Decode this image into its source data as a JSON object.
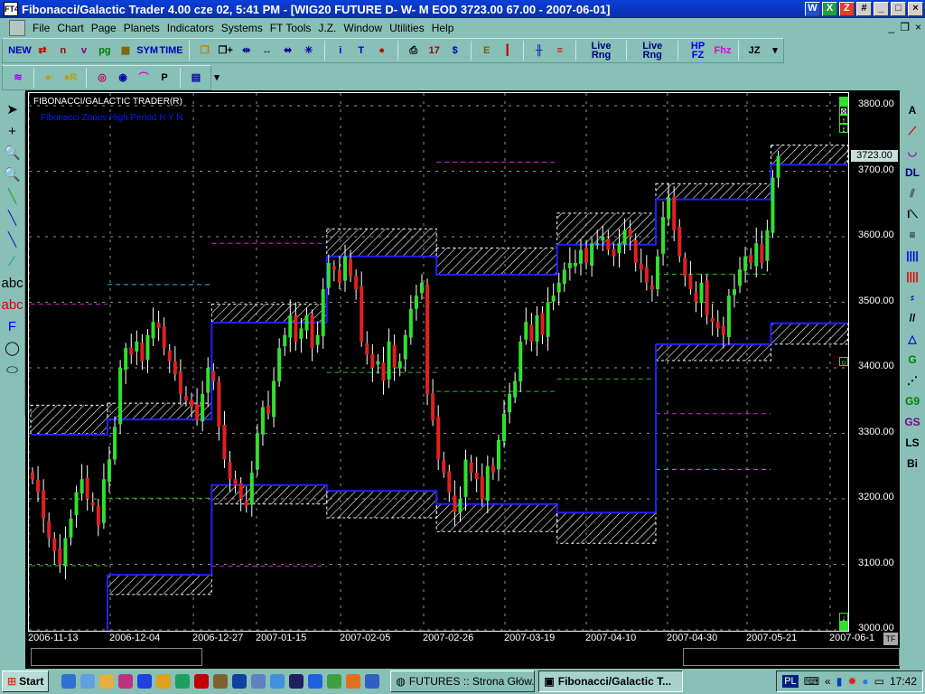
{
  "window": {
    "title": "Fibonacci/Galactic Trader 4.00 cze 02,  5:41 PM - [WIG20 FUTURE D- W- M EOD  3723.00      67.00 - 2007-06-01]",
    "app_icon": "FT4"
  },
  "title_icons": [
    "W",
    "X",
    "Z",
    "#"
  ],
  "menu": [
    "File",
    "Chart",
    "Page",
    "Planets",
    "Indicators",
    "Systems",
    "FT Tools",
    "J.Z.",
    "Window",
    "Utilities",
    "Help"
  ],
  "toolbar1": [
    {
      "name": "new-icon",
      "label": "NEW",
      "color": "#0000c0"
    },
    {
      "name": "open-icon",
      "label": "⇄",
      "color": "#c00"
    },
    {
      "name": "chart-n-icon",
      "label": "n",
      "color": "#a00000"
    },
    {
      "name": "chart-v-icon",
      "label": "v",
      "color": "#800080"
    },
    {
      "name": "pg-icon",
      "label": "pg",
      "color": "#008000"
    },
    {
      "name": "grid-icon",
      "label": "▦",
      "color": "#806000"
    },
    {
      "name": "sym-icon",
      "label": "SYM",
      "color": "#0000c0"
    },
    {
      "name": "time-icon",
      "label": "TIME",
      "color": "#0000c0"
    },
    {
      "name": "sep"
    },
    {
      "name": "windows-icon",
      "label": "❐",
      "color": "#c08000"
    },
    {
      "name": "add-window-icon",
      "label": "❐+",
      "color": "#000"
    },
    {
      "name": "compress-icon",
      "label": "⇹",
      "color": "#0000a0"
    },
    {
      "name": "expand-icon",
      "label": "↔",
      "color": "#0000a0"
    },
    {
      "name": "move-icon",
      "label": "⬌",
      "color": "#0000a0"
    },
    {
      "name": "zoom-icon",
      "label": "✳",
      "color": "#0000a0"
    },
    {
      "name": "sep"
    },
    {
      "name": "info-icon",
      "label": "i",
      "color": "#0000e0"
    },
    {
      "name": "text-icon",
      "label": "T",
      "color": "#0000e0"
    },
    {
      "name": "traffic-light-icon",
      "label": "●",
      "color": "#c00000"
    },
    {
      "name": "sep"
    },
    {
      "name": "print-icon",
      "label": "⎙",
      "color": "#000"
    },
    {
      "name": "calendar-icon",
      "label": "17",
      "color": "#a00"
    },
    {
      "name": "dollar-icon",
      "label": "$",
      "color": "#0000c0"
    },
    {
      "name": "sep"
    },
    {
      "name": "ruler-icon",
      "label": "E",
      "color": "#806000"
    },
    {
      "name": "candle-icon",
      "label": "┃",
      "color": "#c00"
    },
    {
      "name": "sep"
    },
    {
      "name": "bars-icon",
      "label": "╫",
      "color": "#0000c0"
    },
    {
      "name": "fib-lines-icon",
      "label": "≡",
      "color": "#c00"
    },
    {
      "name": "sep"
    },
    {
      "name": "live-rng-red-icon",
      "label": "Live Rng",
      "color": "#000080"
    },
    {
      "name": "sep"
    },
    {
      "name": "live-rng-blue-icon",
      "label": "Live Rng",
      "color": "#000080"
    },
    {
      "name": "sep"
    },
    {
      "name": "hp-fz-icon",
      "label": "HP FZ",
      "color": "#0000e0"
    },
    {
      "name": "fhz-icon",
      "label": "Fhz",
      "color": "#e000e0"
    },
    {
      "name": "sep"
    },
    {
      "name": "jz-icon",
      "label": "JZ",
      "color": "#000"
    }
  ],
  "toolbar2": [
    {
      "name": "waves-icon",
      "label": "≋",
      "color": "#a000ff"
    },
    {
      "name": "sep"
    },
    {
      "name": "planet-icon",
      "label": "●·",
      "color": "#c0a000"
    },
    {
      "name": "planet-r-icon",
      "label": "●R",
      "color": "#c0a000"
    },
    {
      "name": "sep"
    },
    {
      "name": "target-icon",
      "label": "◎",
      "color": "#c00060"
    },
    {
      "name": "circle-dots-icon",
      "label": "◉",
      "color": "#0000a0"
    },
    {
      "name": "arc-icon",
      "label": "⌒",
      "color": "#e000e0"
    },
    {
      "name": "p-curve-icon",
      "label": "P",
      "color": "#000"
    },
    {
      "name": "sep"
    },
    {
      "name": "template-icon",
      "label": "▤",
      "color": "#0000a0"
    }
  ],
  "left_tools": [
    {
      "name": "pointer-icon",
      "label": "➤",
      "color": "#000"
    },
    {
      "name": "crosshair-icon",
      "label": "+",
      "color": "#000"
    },
    {
      "name": "zoom-find-icon",
      "label": "🔍",
      "color": "#000"
    },
    {
      "name": "zoom-find-disabled-icon",
      "label": "🔍",
      "color": "#6a9"
    },
    {
      "name": "trendline-green-icon",
      "label": "╲",
      "color": "#20b020"
    },
    {
      "name": "trendline-blue-icon",
      "label": "╲",
      "color": "#2020c0"
    },
    {
      "name": "trendline-steep-icon",
      "label": "╲",
      "color": "#2020c0"
    },
    {
      "name": "pencil-icon",
      "label": "∕",
      "color": "#00a0c0"
    },
    {
      "name": "text-abc-icon",
      "label": "abc",
      "color": "#000"
    },
    {
      "name": "delete-text-icon",
      "label": "abc",
      "color": "#e00000"
    },
    {
      "name": "font-icon",
      "label": "F",
      "color": "#0000e0"
    },
    {
      "name": "circle-icon",
      "label": "◯",
      "color": "#000"
    },
    {
      "name": "ellipse-icon",
      "label": "⬭",
      "color": "#000"
    }
  ],
  "right_tools": [
    {
      "name": "andrews-icon",
      "label": "A",
      "color": "#000"
    },
    {
      "name": "fan-icon",
      "label": "⟋",
      "color": "#c00"
    },
    {
      "name": "arcs-icon",
      "label": "◡",
      "color": "#a000a0"
    },
    {
      "name": "dl-icon",
      "label": "DL",
      "color": "#000080"
    },
    {
      "name": "parallel-icon",
      "label": "⫽",
      "color": "#444"
    },
    {
      "name": "retrace-icon",
      "label": "I⟍",
      "color": "#000"
    },
    {
      "name": "hlines-icon",
      "label": "≡",
      "color": "#000"
    },
    {
      "name": "vlines-blue-icon",
      "label": "||||",
      "color": "#0000e0"
    },
    {
      "name": "vlines-red-icon",
      "label": "||||",
      "color": "#e00000"
    },
    {
      "name": "cycles-icon",
      "label": "⸗",
      "color": "#0000e0"
    },
    {
      "name": "diag-icon",
      "label": "//",
      "color": "#000"
    },
    {
      "name": "triangle-icon",
      "label": "△",
      "color": "#0000e0"
    },
    {
      "name": "g-lines-icon",
      "label": "G",
      "color": "#008000"
    },
    {
      "name": "gann-fan-icon",
      "label": "⋰",
      "color": "#000"
    },
    {
      "name": "g9-icon",
      "label": "G9",
      "color": "#008000"
    },
    {
      "name": "gs-icon",
      "label": "GS",
      "color": "#800080"
    },
    {
      "name": "ls-icon",
      "label": "LS",
      "color": "#000"
    },
    {
      "name": "bi-icon",
      "label": "Bi",
      "color": "#000"
    }
  ],
  "chart": {
    "header": "FIBONACCI/GALACTIC TRADER(R)",
    "study": "Fibonacci Zones High Period H Y N",
    "last_price": "3723.00",
    "tf_label": "TF",
    "colors": {
      "up": "#30e030",
      "down": "#e02020",
      "zone_line": "#2020ff",
      "grid": "#909090"
    }
  },
  "chart_data": {
    "type": "candlestick",
    "title": "WIG20 FUTURE D- W- M EOD",
    "ylim": [
      3000,
      3800
    ],
    "yticks": [
      "3000.00",
      "3100.00",
      "3200.00",
      "3300.00",
      "3400.00",
      "3500.00",
      "3600.00",
      "3700.00",
      "3800.00"
    ],
    "xticks": [
      "2006-11-13",
      "2006-12-04",
      "2006-12-27",
      "2007-01-15",
      "2007-02-05",
      "2007-02-26",
      "2007-03-19",
      "2007-04-10",
      "2007-04-30",
      "2007-05-21",
      "2007-06-1"
    ],
    "close": [
      3230,
      3210,
      3170,
      3140,
      3120,
      3100,
      3140,
      3170,
      3210,
      3230,
      3200,
      3190,
      3160,
      3230,
      3260,
      3310,
      3400,
      3430,
      3420,
      3440,
      3410,
      3450,
      3470,
      3460,
      3430,
      3410,
      3390,
      3360,
      3350,
      3340,
      3320,
      3360,
      3400,
      3380,
      3310,
      3260,
      3230,
      3220,
      3200,
      3190,
      3240,
      3300,
      3340,
      3330,
      3380,
      3430,
      3450,
      3480,
      3440,
      3460,
      3480,
      3430,
      3450,
      3520,
      3560,
      3550,
      3530,
      3570,
      3540,
      3520,
      3440,
      3420,
      3400,
      3410,
      3380,
      3440,
      3400,
      3410,
      3450,
      3490,
      3510,
      3530,
      3360,
      3320,
      3260,
      3240,
      3210,
      3180,
      3200,
      3260,
      3240,
      3230,
      3200,
      3250,
      3240,
      3290,
      3330,
      3360,
      3380,
      3440,
      3470,
      3440,
      3480,
      3450,
      3500,
      3510,
      3530,
      3550,
      3560,
      3560,
      3580,
      3560,
      3590,
      3590,
      3600,
      3580,
      3570,
      3590,
      3610,
      3600,
      3560,
      3550,
      3530,
      3520,
      3570,
      3630,
      3660,
      3610,
      3570,
      3540,
      3520,
      3500,
      3530,
      3480,
      3470,
      3460,
      3450,
      3510,
      3520,
      3550,
      3570,
      3560,
      3590,
      3560,
      3610,
      3690,
      3723
    ],
    "zones": [
      {
        "from": 0,
        "to": 14,
        "high": 3298,
        "high_top": 3343,
        "low": null,
        "low_bottom": null
      },
      {
        "from": 14,
        "to": 33,
        "high": 3321,
        "high_top": 3346,
        "low": 3084,
        "low_bottom": 3054
      },
      {
        "from": 33,
        "to": 54,
        "high": 3469,
        "high_top": 3497,
        "low": 3221,
        "low_bottom": 3192
      },
      {
        "from": 54,
        "to": 74,
        "high": 3570,
        "high_top": 3612,
        "low": 3212,
        "low_bottom": 3171
      },
      {
        "from": 74,
        "to": 96,
        "high": 3542,
        "high_top": 3583,
        "low": 3192,
        "low_bottom": 3150
      },
      {
        "from": 96,
        "to": 114,
        "high": 3588,
        "high_top": 3636,
        "low": 3179,
        "low_bottom": 3132
      },
      {
        "from": 114,
        "to": 135,
        "high": 3657,
        "high_top": 3681,
        "low": 3436,
        "low_bottom": 3411
      },
      {
        "from": 135,
        "to": 149,
        "high": 3710,
        "high_top": 3740,
        "low": 3468,
        "low_bottom": 3436
      }
    ],
    "levels": [
      {
        "from": 0,
        "to": 14,
        "value": 3098,
        "color": "#20c020"
      },
      {
        "from": 0,
        "to": 14,
        "value": 3497,
        "color": "#e020e0"
      },
      {
        "from": 14,
        "to": 33,
        "value": 3201,
        "color": "#20c020"
      },
      {
        "from": 14,
        "to": 33,
        "value": 3527,
        "color": "#20c0e0"
      },
      {
        "from": 33,
        "to": 54,
        "value": 3590,
        "color": "#e020e0"
      },
      {
        "from": 33,
        "to": 54,
        "value": 3097,
        "color": "#e020e0"
      },
      {
        "from": 54,
        "to": 74,
        "value": 3393,
        "color": "#20c020"
      },
      {
        "from": 74,
        "to": 96,
        "value": 3364,
        "color": "#20c020"
      },
      {
        "from": 74,
        "to": 96,
        "value": 3714,
        "color": "#e020e0"
      },
      {
        "from": 96,
        "to": 114,
        "value": 3383,
        "color": "#20c020"
      },
      {
        "from": 114,
        "to": 135,
        "value": 3543,
        "color": "#20c020"
      },
      {
        "from": 114,
        "to": 135,
        "value": 3330,
        "color": "#e020e0"
      },
      {
        "from": 114,
        "to": 135,
        "value": 3245,
        "color": "#20c0e0"
      }
    ]
  },
  "taskbar": {
    "start": "Start",
    "quicklaunch": [
      "#3070d0",
      "#60a0e0",
      "#e0b040",
      "#c03080",
      "#2040e0",
      "#e0a020",
      "#20a060",
      "#c00000",
      "#806030",
      "#1040a0",
      "#6080c0",
      "#4090e0",
      "#202060",
      "#2060e0",
      "#40a040",
      "#e07020",
      "#3060c0"
    ],
    "tasks": [
      {
        "label": "FUTURES :: Strona Głów...",
        "active": false
      },
      {
        "label": "Fibonacci/Galactic T...",
        "active": true
      }
    ],
    "lang": "PL",
    "clock": "17:42"
  }
}
